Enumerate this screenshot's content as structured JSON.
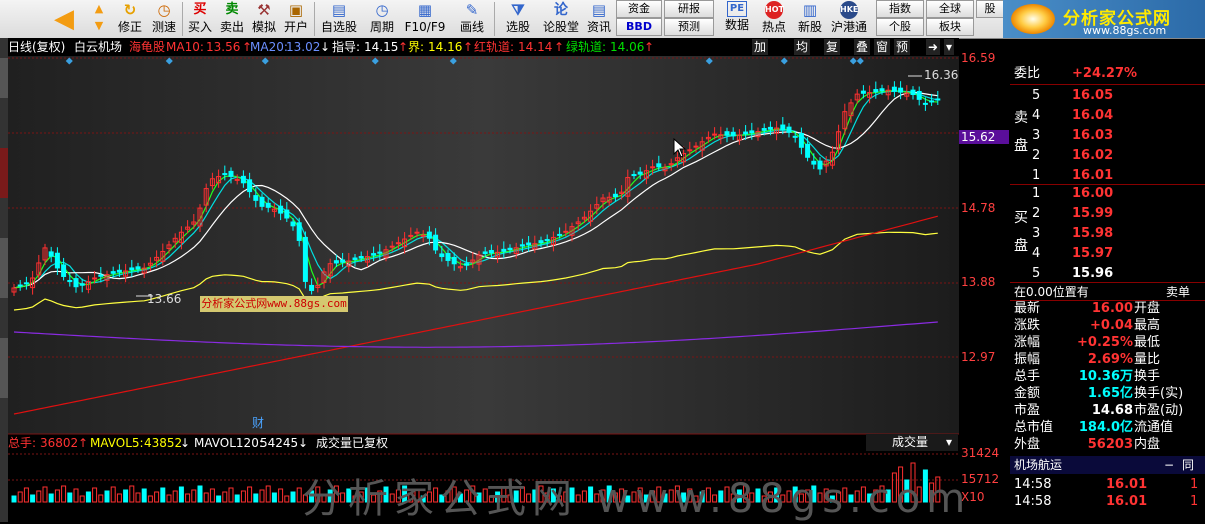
{
  "toolbar": {
    "items": [
      {
        "label": "",
        "icon": "back-arrow-icon"
      },
      {
        "label": "修正",
        "icon": "refresh-icon"
      },
      {
        "label": "测速",
        "icon": "clock-icon"
      },
      {
        "label": "买入",
        "icon": "buy-icon",
        "glyph": "买"
      },
      {
        "label": "卖出",
        "icon": "sell-icon",
        "glyph": "卖"
      },
      {
        "label": "模拟",
        "icon": "hammer-icon"
      },
      {
        "label": "开户",
        "icon": "briefcase-icon"
      },
      {
        "label": "自选股",
        "icon": "star-icon"
      },
      {
        "label": "周期",
        "icon": "clock-icon"
      },
      {
        "label": "F10/F9",
        "icon": "f10-icon"
      },
      {
        "label": "画线",
        "icon": "pen-icon"
      },
      {
        "label": "选股",
        "icon": "funnel-icon"
      },
      {
        "label": "论股堂",
        "icon": "forum-icon",
        "glyph": "论"
      },
      {
        "label": "资讯",
        "icon": "news-icon"
      },
      {
        "label": "数据",
        "icon": "pe-icon",
        "glyph": "PE"
      },
      {
        "label": "热点",
        "icon": "hot-icon",
        "glyph": "HOT"
      },
      {
        "label": "新股",
        "icon": "newstock-icon"
      },
      {
        "label": "沪港通",
        "icon": "hk-icon",
        "glyph": "HKE"
      }
    ],
    "small_buttons": [
      "资金",
      "研报",
      "BBD",
      "预测",
      "指数",
      "全球",
      "个股",
      "板块",
      "股"
    ],
    "logo_text": "分析家公式网",
    "logo_url": "www.88gs.com"
  },
  "infobar": {
    "title": "日线(复权)",
    "stock": "白云机场",
    "tag": "海龟股",
    "ma10_label": "MA10:",
    "ma10": "13.56",
    "ma20_label": "MA20:",
    "ma20": "13.02",
    "zhidao_label": "指导:",
    "zhidao": "14.15",
    "jie_label": "界:",
    "jie": "14.16",
    "hong_label": "红轨道:",
    "hong": "14.14",
    "lv_label": "绿轨道:",
    "lv": "14.06",
    "buttons": [
      "加自选",
      "均线",
      "复权",
      "叠",
      "窗",
      "预测"
    ]
  },
  "axis": {
    "labels": [
      "16.59",
      "15.62",
      "14.78",
      "13.88",
      "12.97"
    ],
    "current": "15.62",
    "vol_labels": [
      "31424",
      "15712",
      "X10"
    ]
  },
  "annotations": {
    "high": "16.36",
    "low": "13.66",
    "cai": "财",
    "wm_box": "分析家公式网www.88gs.com"
  },
  "volbar": {
    "total_label": "总手:",
    "total": "36802",
    "mavol5_label": "MAVOL5:",
    "mavol5": "43852",
    "mavol120_label": "MAVOL120:",
    "mavol120": "54245",
    "note": "成交量已复权",
    "select": "成交量"
  },
  "watermark": "分析家公式网 www.88gs.com",
  "panel": {
    "weibi_label": "委比",
    "weibi": "+24.27%",
    "sell_label": "卖盘",
    "sells": [
      {
        "n": "5",
        "p": "16.05"
      },
      {
        "n": "4",
        "p": "16.04"
      },
      {
        "n": "3",
        "p": "16.03"
      },
      {
        "n": "2",
        "p": "16.02"
      },
      {
        "n": "1",
        "p": "16.01"
      }
    ],
    "buy_label": "买盘",
    "buys": [
      {
        "n": "1",
        "p": "16.00"
      },
      {
        "n": "2",
        "p": "15.99"
      },
      {
        "n": "3",
        "p": "15.98"
      },
      {
        "n": "4",
        "p": "15.97"
      },
      {
        "n": "5",
        "p": "15.96"
      }
    ],
    "pos_left": "在0.00位置有",
    "pos_right": "卖单",
    "stats": [
      {
        "k": "最新",
        "v": "16.00",
        "k2": "开盘"
      },
      {
        "k": "涨跌",
        "v": "+0.04",
        "k2": "最高"
      },
      {
        "k": "涨幅",
        "v": "+0.25%",
        "k2": "最低"
      },
      {
        "k": "振幅",
        "v": "2.69%",
        "k2": "量比"
      },
      {
        "k": "总手",
        "v": "10.36万",
        "k2": "换手"
      },
      {
        "k": "金额",
        "v": "1.65亿",
        "k2": "换手(实)"
      },
      {
        "k": "市盈",
        "v": "14.68",
        "k2": "市盈(动)"
      },
      {
        "k": "总市值",
        "v": "184.0亿",
        "k2": "流通值"
      },
      {
        "k": "外盘",
        "v": "56203",
        "k2": "内盘"
      }
    ],
    "nav_label": "机场航运",
    "nav_right": "同",
    "ticks": [
      {
        "t": "14:58",
        "p": "16.01",
        "v": "1"
      },
      {
        "t": "14:58",
        "p": "16.01",
        "v": "1"
      }
    ]
  }
}
